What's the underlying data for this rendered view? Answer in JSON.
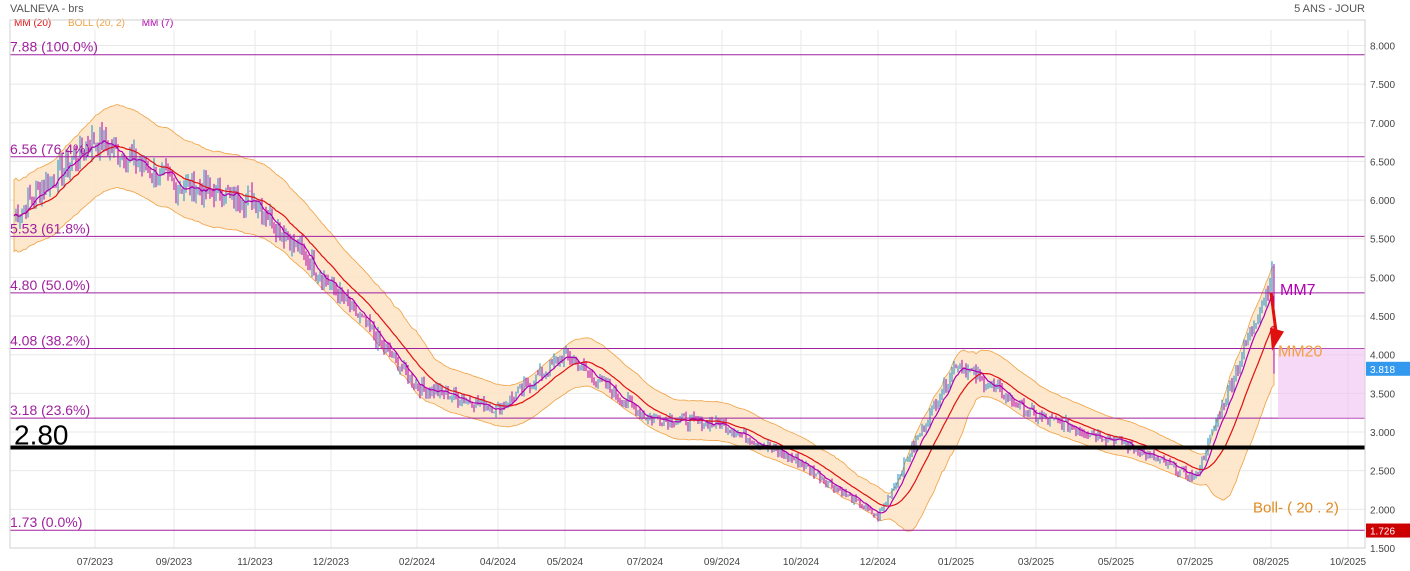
{
  "header": {
    "title": "VALNEVA - brs",
    "period": "5 ANS - JOUR"
  },
  "legend": {
    "items": [
      {
        "label": "MM (20)",
        "color": "#e01010"
      },
      {
        "label": "BOLL (20, 2)",
        "color": "#f0a040"
      },
      {
        "label": "MM (7)",
        "color": "#b000b0"
      }
    ]
  },
  "colors": {
    "fib": "#a020a0",
    "mm20": "#e01010",
    "mm7": "#b000b0",
    "boll_fill": "#fde3c4",
    "boll_line": "#f0a040",
    "up": "#1a8fd0",
    "down": "#b000b0",
    "grid": "#e8e8e8",
    "last_tag": "#3399ee",
    "low_tag": "#cc0000"
  },
  "chart_data": {
    "type": "candlestick",
    "title": "VALNEVA - brs",
    "period": "5 ANS - JOUR",
    "ylim": [
      1.5,
      8.2
    ],
    "y_ticks": [
      "8.000",
      "7.500",
      "7.000",
      "6.500",
      "6.000",
      "5.500",
      "5.000",
      "4.500",
      "4.000",
      "3.500",
      "3.000",
      "2.500",
      "2.000",
      "1.500"
    ],
    "y_tick_values": [
      8.0,
      7.5,
      7.0,
      6.5,
      6.0,
      5.5,
      5.0,
      4.5,
      4.0,
      3.5,
      3.0,
      2.5,
      2.0,
      1.5
    ],
    "x_ticks": [
      "07/2023",
      "09/2023",
      "11/2023",
      "12/2023",
      "02/2024",
      "04/2024",
      "05/2024",
      "07/2024",
      "09/2024",
      "10/2024",
      "12/2024",
      "01/2025",
      "03/2025",
      "05/2025",
      "07/2025",
      "08/2025",
      "10/2025"
    ],
    "fib_levels": [
      {
        "value": 7.88,
        "label": "7.88  (100.0%)"
      },
      {
        "value": 6.56,
        "label": "6.56  (76.4%)"
      },
      {
        "value": 5.53,
        "label": "5.53  (61.8%)"
      },
      {
        "value": 4.8,
        "label": "4.80  (50.0%)"
      },
      {
        "value": 4.08,
        "label": "4.08  (38.2%)"
      },
      {
        "value": 3.18,
        "label": "3.18  (23.6%)"
      },
      {
        "value": 1.73,
        "label": "1.73  (0.0%)"
      }
    ],
    "support": {
      "value": 2.8,
      "label": "2.80"
    },
    "annotations": {
      "mm7": "MM7",
      "mm20": "MM20",
      "boll": "Boll- ( 20 . 2)"
    },
    "last_price": "3.818",
    "low_price": "1.726",
    "price_path_months": [
      "05/2023",
      "07/2023",
      "09/2023",
      "11/2023",
      "12/2023",
      "02/2024",
      "04/2024",
      "05/2024",
      "07/2024",
      "09/2024",
      "10/2024",
      "12/2024",
      "01/2025",
      "03/2025",
      "05/2025",
      "07/2025",
      "08/2025"
    ],
    "price_path": [
      5.8,
      6.8,
      6.2,
      6.0,
      4.9,
      3.6,
      3.3,
      4.0,
      3.2,
      3.1,
      2.6,
      1.9,
      3.9,
      3.2,
      2.9,
      2.4,
      5.0
    ],
    "close_last": 3.818
  }
}
